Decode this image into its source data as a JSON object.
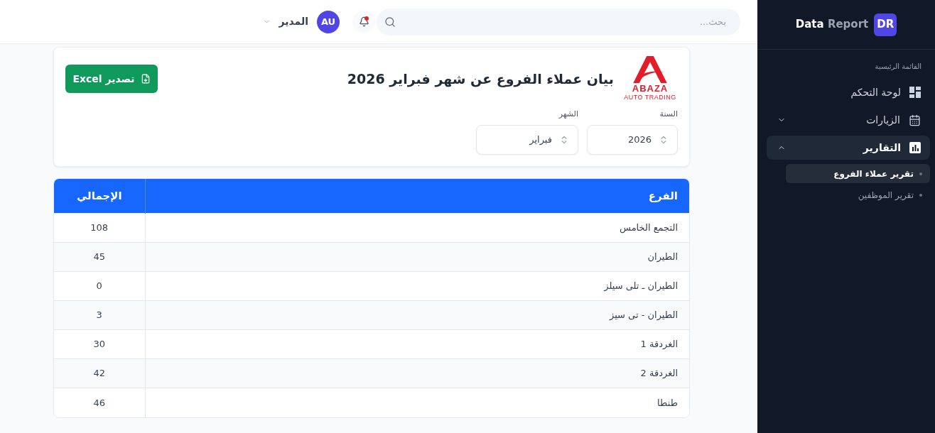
{
  "sidebar": {
    "brand": {
      "badge": "DR",
      "title_primary": "Data",
      "title_secondary": "Report"
    },
    "section_label": "القائمة الرئيسية",
    "items": [
      {
        "kind": "link",
        "label": "لوحة التحكم",
        "selected": false
      },
      {
        "kind": "group",
        "label": "الزيارات",
        "selected": false,
        "expanded": false
      },
      {
        "kind": "group",
        "label": "التقارير",
        "selected": true,
        "expanded": true,
        "children": [
          {
            "label": "تقرير عملاء الفروع",
            "selected": true
          },
          {
            "label": "تقرير الموظفين",
            "selected": false
          }
        ]
      }
    ]
  },
  "header": {
    "search": {
      "placeholder": "بحث..."
    },
    "notifications": {
      "unread": true
    },
    "user": {
      "initials": "AU",
      "name": "المدير"
    }
  },
  "report": {
    "logo": {
      "name": "ABAZA",
      "tagline": "AUTO TRADING"
    },
    "title": "بيان عملاء الفروع عن شهر فبراير 2026",
    "export_button": "تصدير Excel",
    "filters": [
      {
        "label": "السنة",
        "value": "2026"
      },
      {
        "label": "الشهر",
        "value": "فبراير"
      }
    ]
  },
  "table": {
    "columns": [
      "الفرع",
      "الإجمالي"
    ],
    "rows": [
      [
        "التجمع الخامس",
        "108"
      ],
      [
        "الطيران",
        "45"
      ],
      [
        "الطيران ـ تلى سيلز",
        "0"
      ],
      [
        "الطيران - تى سيز",
        "3"
      ],
      [
        "الغردقة 1",
        "30"
      ],
      [
        "الغردقة 2",
        "42"
      ],
      [
        "طنطا",
        "46"
      ]
    ]
  }
}
